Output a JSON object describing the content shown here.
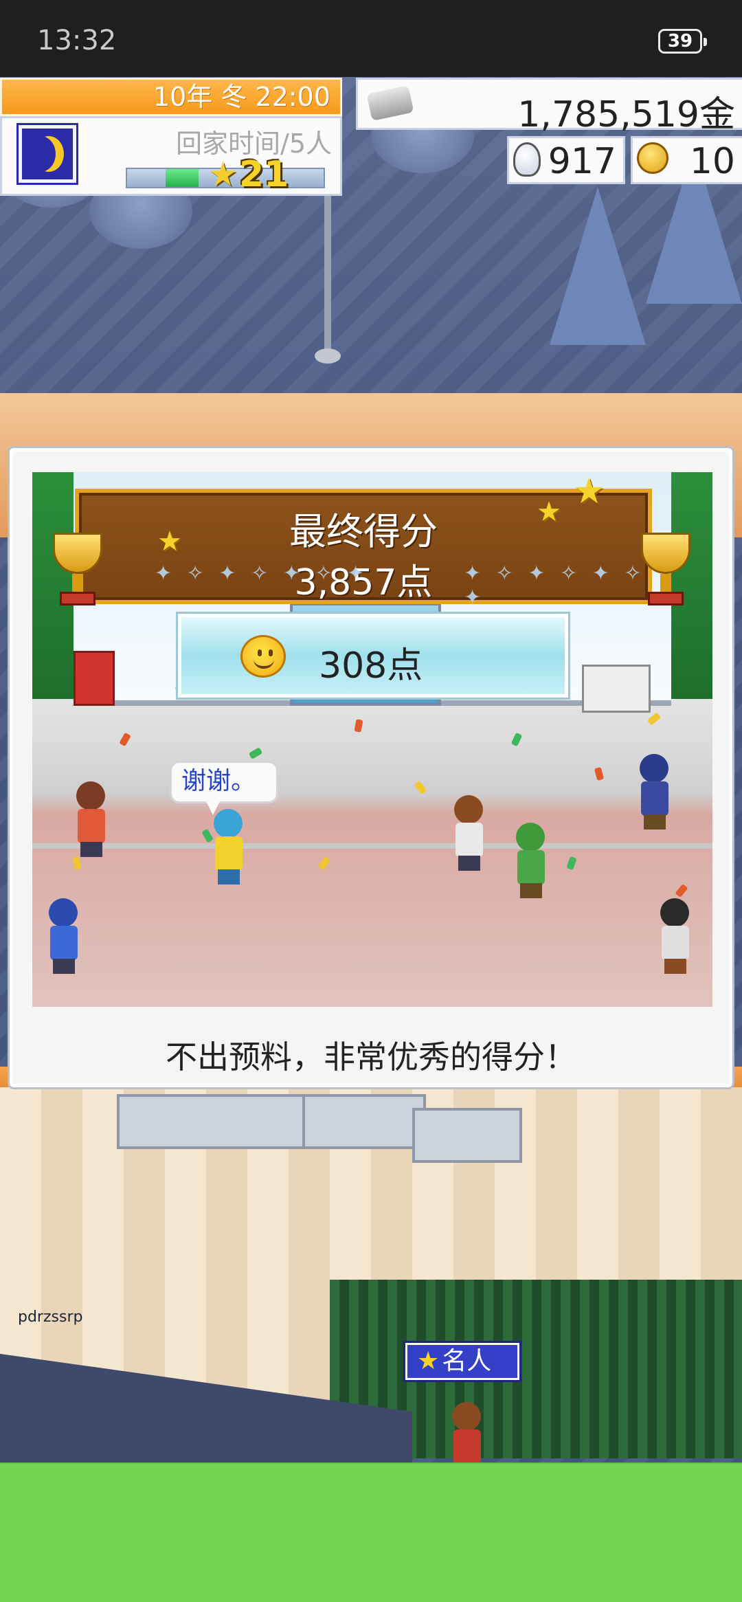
{
  "status_bar": {
    "time": "13:32",
    "battery": "39"
  },
  "hud": {
    "date": "10年 冬 22:00",
    "home_text": "回家时间/5人",
    "rank": "21",
    "money": "1,785,519金",
    "ideas": "917",
    "medals": "10"
  },
  "result": {
    "title": "最终得分",
    "score": "3,857点",
    "sub_score": "308点",
    "speech": "谢谢。",
    "comment": "不出预料，非常优秀的得分！"
  },
  "watermark": "pdrzssrp",
  "celebrity_tag": "名人",
  "colors": {
    "hud_orange": "#f59a1c",
    "banner_brown": "#7a4312",
    "bottom_green": "#73d653",
    "tag_blue": "#3540c8"
  },
  "icons": [
    "moon-icon",
    "star-icon",
    "money-icon",
    "bulb-icon",
    "medal-icon",
    "trophy-icon",
    "smiley-icon"
  ]
}
